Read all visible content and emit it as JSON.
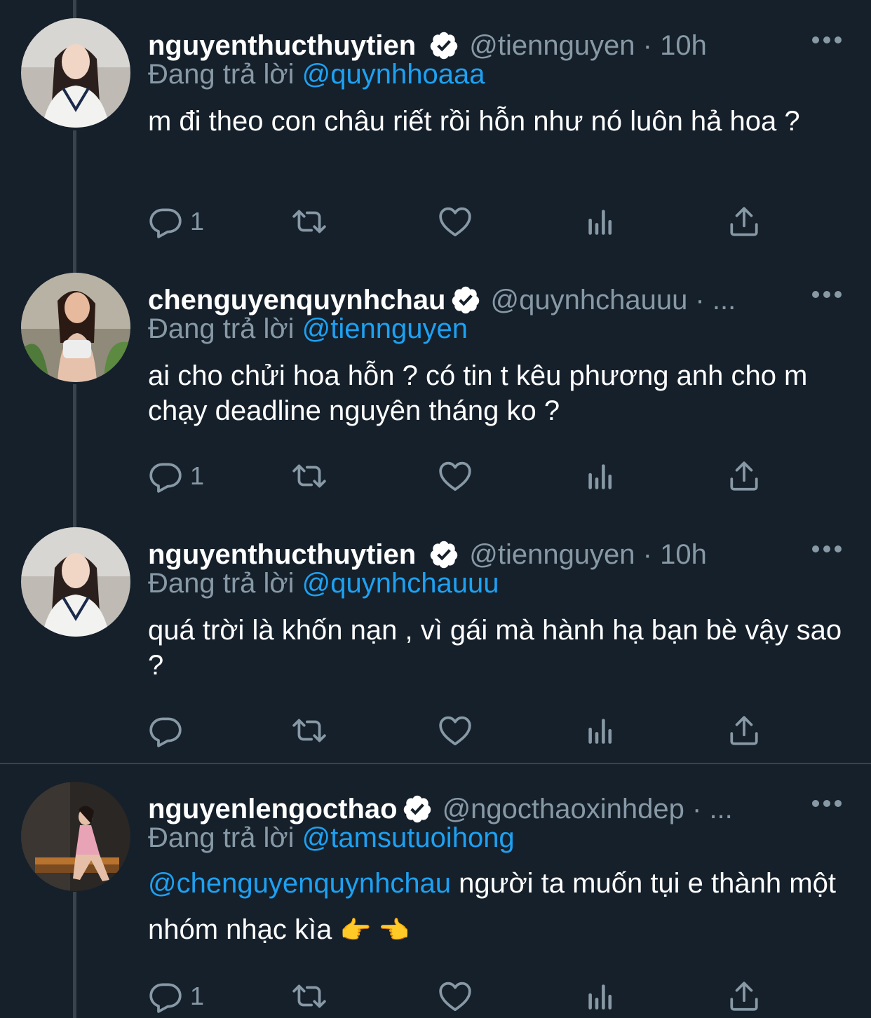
{
  "colors": {
    "background": "#15202b",
    "text_primary": "#ffffff",
    "text_secondary": "#8899a6",
    "accent": "#1da1f2",
    "thread_line": "#38444d"
  },
  "icons": {
    "verified": "verified-badge-icon",
    "more": "more-options-icon",
    "reply": "reply-icon",
    "retweet": "retweet-icon",
    "like": "like-icon",
    "analytics": "analytics-icon",
    "share": "share-icon"
  },
  "tweets": [
    {
      "display_name": "nguyenthucthuytien",
      "handle_meta": "@tiennguyen · 10h",
      "reply_prefix": "Đang trả lời",
      "reply_to": "@quynhhoaaa",
      "text": "m đi theo con châu riết rồi hỗn như nó luôn hả hoa ?",
      "reply_count": "1"
    },
    {
      "display_name": "chenguyenquynhchau",
      "handle_meta": "@quynhchauuu · ...",
      "reply_prefix": "Đang trả lời",
      "reply_to": "@tiennguyen",
      "text": "ai cho chửi hoa hỗn ? có tin t kêu phương anh cho m chạy deadline nguyên tháng ko ?",
      "reply_count": "1"
    },
    {
      "display_name": "nguyenthucthuytien",
      "handle_meta": "@tiennguyen · 10h",
      "reply_prefix": "Đang trả lời",
      "reply_to": "@quynhchauuu",
      "text": "quá trời là khốn nạn , vì gái mà hành hạ bạn bè vậy sao ?",
      "reply_count": ""
    },
    {
      "display_name": "nguyenlengocthao",
      "handle_meta": "@ngocthaoxinhdep · ...",
      "reply_prefix": "Đang trả lời",
      "reply_to": "@tamsutuoihong",
      "text_mention": "@chenguyenquynhchau",
      "text": " người ta muốn tụi e thành một nhóm nhạc kìa ",
      "text_emoji": "👉 👈",
      "reply_count": "1"
    }
  ]
}
